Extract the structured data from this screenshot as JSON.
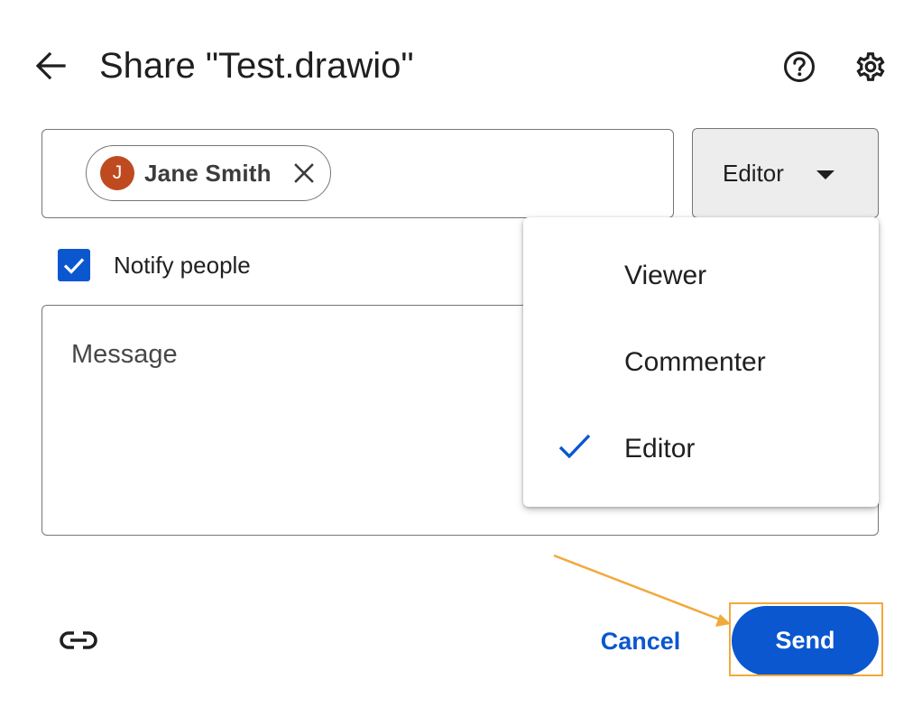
{
  "dialog": {
    "title": "Share \"Test.drawio\""
  },
  "header": {
    "back_icon": "arrow-back-icon",
    "help_icon": "help-circle-icon",
    "settings_icon": "gear-icon"
  },
  "people": {
    "chips": [
      {
        "initial": "J",
        "name": "Jane Smith",
        "avatar_color": "#bf4a1f"
      }
    ]
  },
  "role_select": {
    "selected": "Editor"
  },
  "role_menu": {
    "items": [
      {
        "label": "Viewer",
        "checked": false
      },
      {
        "label": "Commenter",
        "checked": false
      },
      {
        "label": "Editor",
        "checked": true
      }
    ]
  },
  "notify": {
    "label": "Notify people",
    "checked": true
  },
  "message": {
    "placeholder": "Message"
  },
  "footer": {
    "link_icon": "link-icon",
    "cancel_label": "Cancel",
    "send_label": "Send"
  },
  "colors": {
    "accent": "#0b57d0",
    "annotation": "#f2a93b"
  }
}
